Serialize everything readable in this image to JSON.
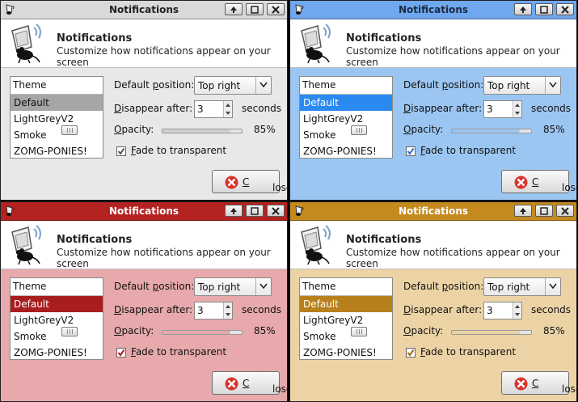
{
  "dialog": {
    "window_title": "Notifications",
    "header_title": "Notifications",
    "header_subtitle": "Customize how notifications appear on your screen",
    "theme_list_header": "Theme",
    "themes": [
      "Default",
      "LightGreyV2",
      "Smoke",
      "ZOMG-PONIES!"
    ],
    "default_position_pre": "Default ",
    "default_position_key": "p",
    "default_position_post": "osition:",
    "position_value": "Top right",
    "disappear_key": "D",
    "disappear_post": "isappear after:",
    "disappear_value": "3",
    "seconds_label": "seconds",
    "opacity_key": "O",
    "opacity_post": "pacity:",
    "opacity_value": "85%",
    "opacity_level": 0.85,
    "fade_key": "F",
    "fade_post": "ade to transparent",
    "fade_checked": true,
    "close_key": "C",
    "close_post": "lose"
  },
  "windows": [
    {
      "theme": "default",
      "titlebar_color": "#d9d9d9",
      "titlebar_text": "#222222",
      "body_color": "#e8e8e8",
      "selected_bg": "#a6a6a6",
      "selected_text": "#111111",
      "slider_fill": "#cfcfcf",
      "check_color": "#555555",
      "selected_theme": "Default"
    },
    {
      "theme": "blue",
      "titlebar_color": "#6fa8ee",
      "titlebar_text": "#1b2a44",
      "body_color": "#9cc6f2",
      "selected_bg": "#2a8af0",
      "selected_text": "#ffffff",
      "slider_fill": "#9cc6f2",
      "check_color": "#2a6fd0",
      "selected_theme": "Default"
    },
    {
      "theme": "red",
      "titlebar_color": "#b42222",
      "titlebar_text": "#ffffff",
      "body_color": "#e7a9ab",
      "selected_bg": "#a81d1d",
      "selected_text": "#ffffff",
      "slider_fill": "#e7a9ab",
      "check_color": "#b01818",
      "selected_theme": "Default"
    },
    {
      "theme": "gold",
      "titlebar_color": "#c58a1e",
      "titlebar_text": "#ffffff",
      "body_color": "#ecd3a5",
      "selected_bg": "#b8801c",
      "selected_text": "#ffffff",
      "slider_fill": "#ecd3a5",
      "check_color": "#9a6a10",
      "selected_theme": "Default"
    }
  ]
}
